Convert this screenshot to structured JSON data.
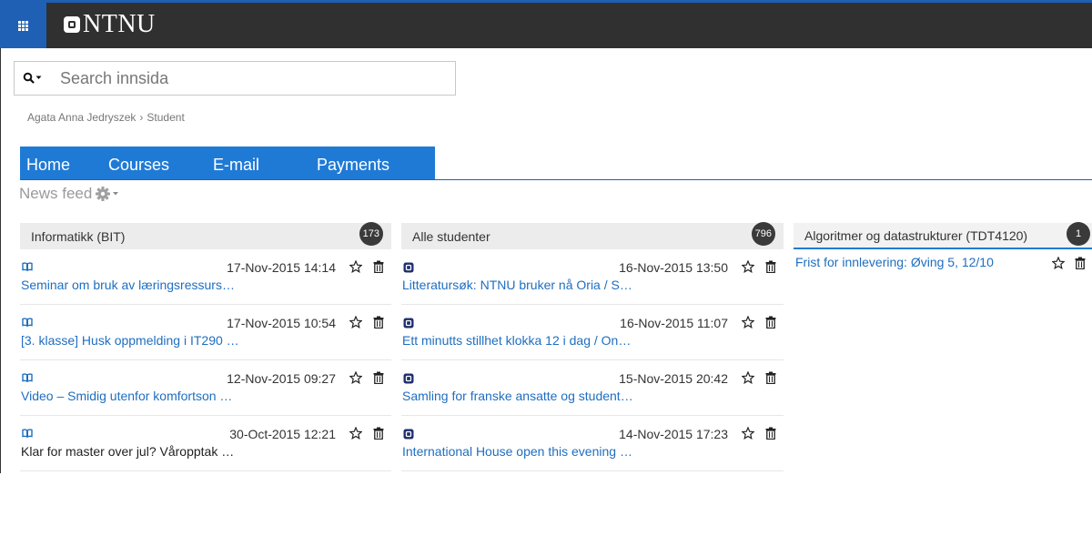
{
  "brand": {
    "name": "NTNU"
  },
  "search": {
    "placeholder": "Search innsida"
  },
  "breadcrumb": {
    "user": "Agata Anna Jedryszek",
    "separator": "›",
    "role": "Student"
  },
  "nav": {
    "tabs": [
      {
        "label": "Home"
      },
      {
        "label": "Courses"
      },
      {
        "label": "E-mail"
      },
      {
        "label": "Payments"
      }
    ]
  },
  "news_feed": {
    "label": "News feed"
  },
  "columns": [
    {
      "title": "Informatikk (BIT)",
      "count": "173",
      "items": [
        {
          "date": "17-Nov-2015 14:14",
          "title": "Seminar om bruk av læringsressurs…",
          "icon": "book-icon"
        },
        {
          "date": "17-Nov-2015 10:54",
          "title": "[3. klasse] Husk oppmelding i IT290 …",
          "icon": "book-icon"
        },
        {
          "date": "12-Nov-2015 09:27",
          "title": "Video – Smidig utenfor komfortson …",
          "icon": "book-icon"
        },
        {
          "date": "30-Oct-2015 12:21",
          "title": "Klar for master over jul? Våropptak …",
          "icon": "book-icon"
        }
      ]
    },
    {
      "title": "Alle studenter",
      "count": "796",
      "items": [
        {
          "date": "16-Nov-2015 13:50",
          "title": "Litteratursøk: NTNU bruker nå Oria / S…",
          "icon": "ntnu-logo-icon"
        },
        {
          "date": "16-Nov-2015 11:07",
          "title": "Ett minutts stillhet klokka 12 i dag / On…",
          "icon": "ntnu-logo-icon"
        },
        {
          "date": "15-Nov-2015 20:42",
          "title": "Samling for franske ansatte og student…",
          "icon": "ntnu-logo-icon"
        },
        {
          "date": "14-Nov-2015 17:23",
          "title": "International House open this evening …",
          "icon": "ntnu-logo-icon"
        }
      ]
    },
    {
      "title": "Algoritmer og datastrukturer (TDT4120)",
      "count": "1",
      "items": [
        {
          "title": "Frist for innlevering: Øving 5, 12/10"
        }
      ]
    }
  ],
  "colors": {
    "brand_blue": "#1f5fb4",
    "tab_blue": "#1f7ad6",
    "link_blue": "#1f6ec0",
    "topbar": "#303030"
  }
}
